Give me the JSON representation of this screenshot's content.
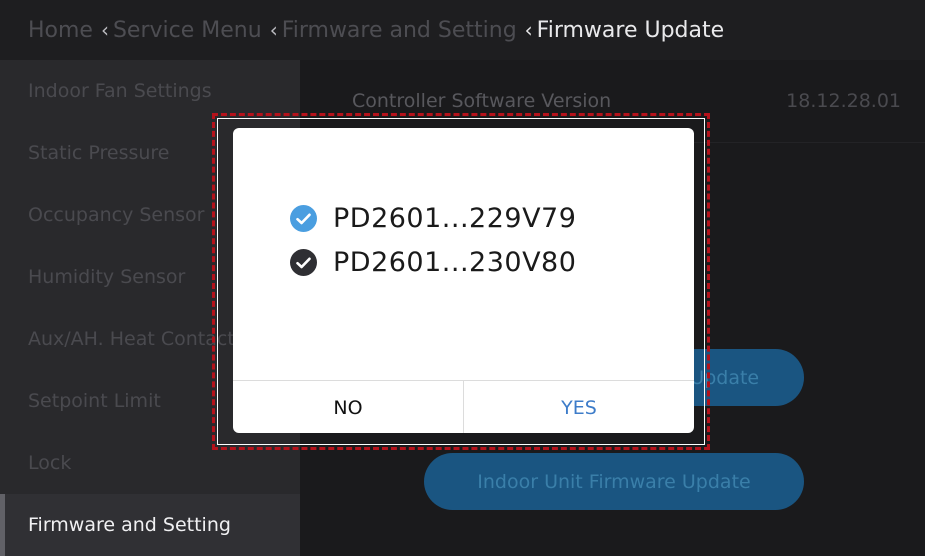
{
  "header": {
    "crumbs": [
      {
        "label": "Home"
      },
      {
        "label": "Service Menu"
      },
      {
        "label": "Firmware and Setting"
      },
      {
        "label": "Firmware Update"
      }
    ],
    "separator": "‹"
  },
  "sidebar": {
    "items": [
      {
        "label": "Indoor Fan Settings"
      },
      {
        "label": "Static Pressure"
      },
      {
        "label": "Occupancy Sensor"
      },
      {
        "label": "Humidity Sensor"
      },
      {
        "label": "Aux/AH. Heat Contact"
      },
      {
        "label": "Setpoint Limit"
      },
      {
        "label": "Lock"
      },
      {
        "label": "Firmware and Setting",
        "active": true
      }
    ]
  },
  "main": {
    "controller_label": "Controller Software Version",
    "controller_version": "18.12.28.01",
    "outdoor_update_label": "Outdoor Unit Firmware Update",
    "indoor_update_label": "Indoor Unit Firmware Update"
  },
  "dialog": {
    "files": [
      {
        "name": "PD2601...229V79",
        "state": "selected",
        "icon": "check-circle-icon",
        "color": "#4a9ee0"
      },
      {
        "name": "PD2601...230V80",
        "state": "checked",
        "icon": "check-circle-icon",
        "color": "#2f2f33"
      }
    ],
    "no_label": "NO",
    "yes_label": "YES"
  },
  "colors": {
    "accent": "#3d7cc9",
    "highlight": "#b5121b"
  }
}
